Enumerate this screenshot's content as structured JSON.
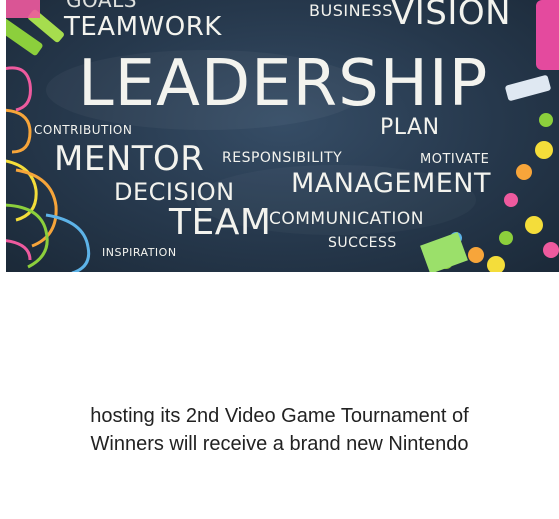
{
  "banner": {
    "words": {
      "goals": "GOALS",
      "teamwork": "TEAMWORK",
      "business": "BUSINESS",
      "vision": "VISION",
      "leadership": "LEADERSHIP",
      "contribution": "CONTRIBUTION",
      "plan": "PLAN",
      "mentor": "MENTOR",
      "responsibility": "RESPONSIBILITY",
      "motivate": "MOTIVATE",
      "decision": "DECISION",
      "management": "MANAGEMENT",
      "team": "TEAM",
      "communication": "COMMUNICATION",
      "success": "SUCCESS",
      "inspiration": "INSPIRATION"
    },
    "colors": {
      "chalkboard": "#26384c",
      "chalk": "#f3f3ee",
      "clip_pink": "#ee5a9e",
      "clip_yellow": "#f4dd3a",
      "clip_green": "#8ccf3c",
      "clip_orange": "#f7a53a"
    }
  },
  "article": {
    "line1": "hosting its 2nd Video Game Tournament of",
    "line2": "Winners will receive a brand new Nintendo"
  }
}
